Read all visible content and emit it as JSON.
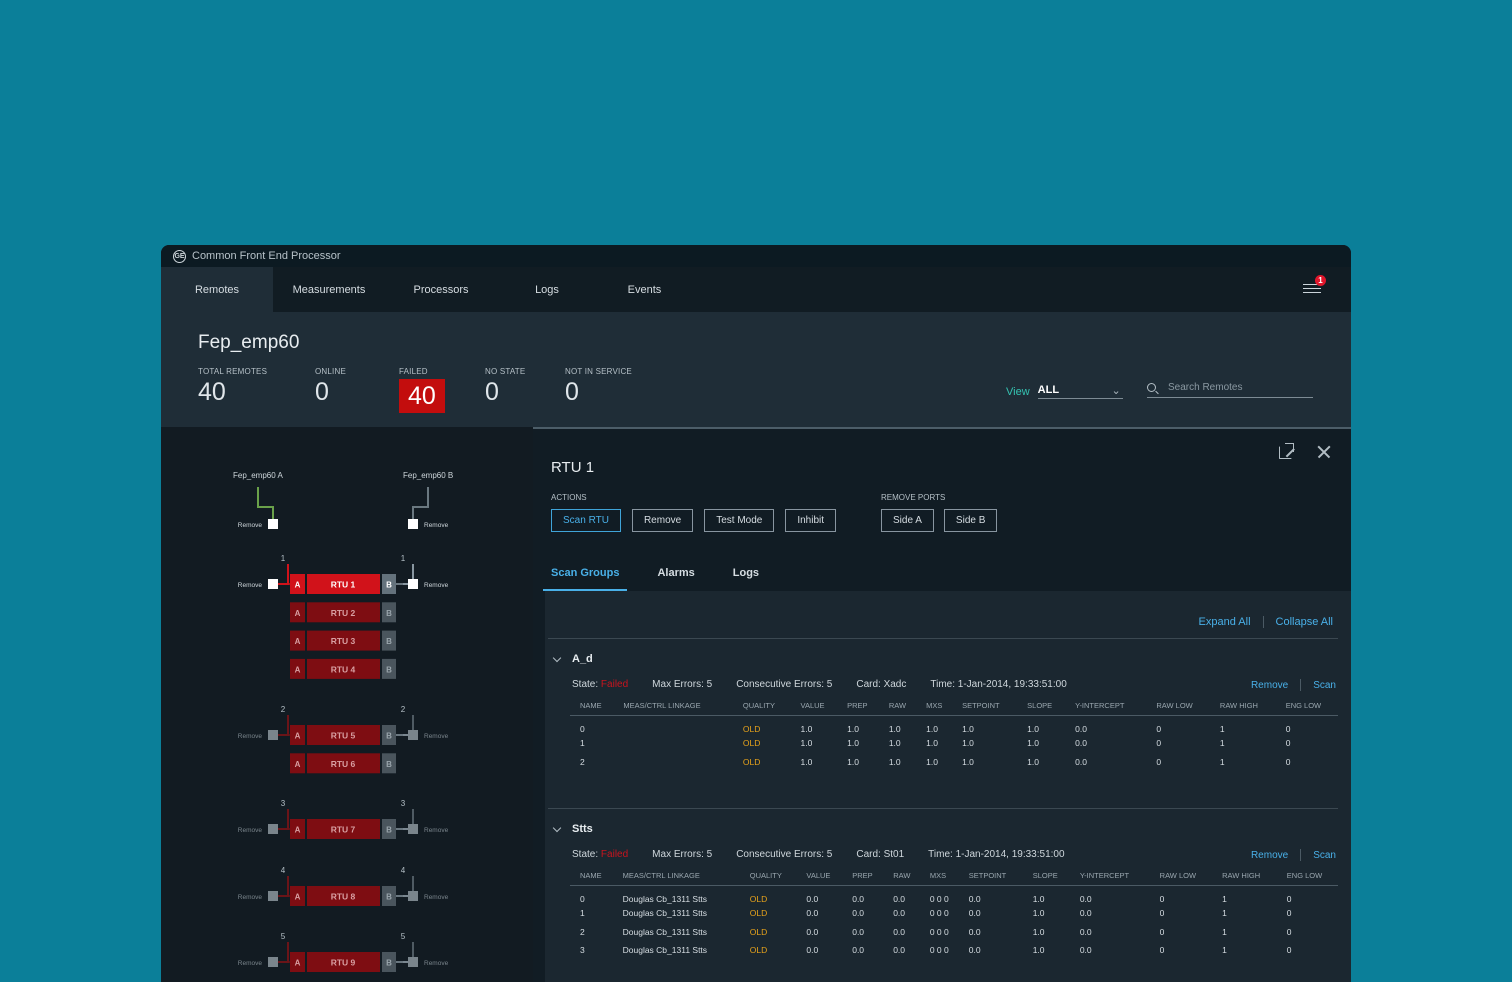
{
  "app": {
    "title": "Common Front End Processor",
    "logo": "GE"
  },
  "nav": {
    "tabs": [
      {
        "label": "Remotes",
        "active": true
      },
      {
        "label": "Measurements",
        "active": false
      },
      {
        "label": "Processors",
        "active": false
      },
      {
        "label": "Logs",
        "active": false
      },
      {
        "label": "Events",
        "active": false
      }
    ],
    "notifications": "1"
  },
  "summary": {
    "title": "Fep_emp60",
    "stats": [
      {
        "label": "TOTAL REMOTES",
        "value": "40"
      },
      {
        "label": "ONLINE",
        "value": "0"
      },
      {
        "label": "FAILED",
        "value": "40"
      },
      {
        "label": "NO STATE",
        "value": "0"
      },
      {
        "label": "NOT IN SERVICE",
        "value": "0"
      }
    ],
    "view_label": "View",
    "view_value": "ALL",
    "search_placeholder": "Search Remotes"
  },
  "topology": {
    "port_a_label": "Fep_emp60 A",
    "port_b_label": "Fep_emp60 B",
    "remove_label": "Remove",
    "side_a": "A",
    "side_b": "B",
    "groups": [
      {
        "num": "1",
        "rtus": [
          "RTU 1",
          "RTU 2",
          "RTU 3",
          "RTU 4"
        ]
      },
      {
        "num": "2",
        "rtus": [
          "RTU 5",
          "RTU 6"
        ]
      },
      {
        "num": "3",
        "rtus": [
          "RTU 7"
        ]
      },
      {
        "num": "4",
        "rtus": [
          "RTU 8"
        ]
      },
      {
        "num": "5",
        "rtus": [
          "RTU 9"
        ]
      }
    ],
    "colors": {
      "selected": "#d1121a",
      "rtu": "#7e0d12",
      "port": "#53606a",
      "green": "#6aa14a"
    }
  },
  "detail": {
    "title": "RTU 1",
    "actions_label": "ACTIONS",
    "actions": [
      "Scan RTU",
      "Remove",
      "Test Mode",
      "Inhibit"
    ],
    "remove_ports_label": "REMOVE PORTS",
    "remove_ports": [
      "Side A",
      "Side B"
    ],
    "tabs": [
      {
        "label": "Scan Groups",
        "active": true
      },
      {
        "label": "Alarms",
        "active": false
      },
      {
        "label": "Logs",
        "active": false
      }
    ],
    "expand_all": "Expand All",
    "collapse_all": "Collapse  All",
    "columns": [
      "NAME",
      "MEAS/CTRL LINKAGE",
      "QUALITY",
      "VALUE",
      "PREP",
      "RAW",
      "MXS",
      "SETPOINT",
      "SLOPE",
      "Y-INTERCEPT",
      "RAW LOW",
      "RAW HIGH",
      "ENG LOW"
    ],
    "groups": [
      {
        "name": "A_d",
        "state_label": "State:",
        "state": "Failed",
        "max_errors": "Max Errors:  5",
        "consecutive": "Consecutive Errors:  5",
        "card": "Card:  Xadc",
        "time": "Time:  1-Jan-2014, 19:33:51:00",
        "remove": "Remove",
        "scan": "Scan",
        "rows": [
          [
            "0",
            "",
            "OLD",
            "1.0",
            "1.0",
            "1.0",
            "1.0",
            "1.0",
            "1.0",
            "0.0",
            "0",
            "1",
            "0"
          ],
          [
            "1",
            "",
            "OLD",
            "1.0",
            "1.0",
            "1.0",
            "1.0",
            "1.0",
            "1.0",
            "0.0",
            "0",
            "1",
            "0"
          ],
          [
            "2",
            "",
            "OLD",
            "1.0",
            "1.0",
            "1.0",
            "1.0",
            "1.0",
            "1.0",
            "0.0",
            "0",
            "1",
            "0"
          ]
        ]
      },
      {
        "name": "Stts",
        "state_label": "State:",
        "state": "Failed",
        "max_errors": "Max Errors:  5",
        "consecutive": "Consecutive Errors:  5",
        "card": "Card:  St01",
        "time": "Time:  1-Jan-2014, 19:33:51:00",
        "remove": "Remove",
        "scan": "Scan",
        "rows": [
          [
            "0",
            "Douglas Cb_1311 Stts",
            "OLD",
            "0.0",
            "0.0",
            "0.0",
            "0 0 0",
            "0.0",
            "1.0",
            "0.0",
            "0",
            "1",
            "0"
          ],
          [
            "1",
            "Douglas Cb_1311 Stts",
            "OLD",
            "0.0",
            "0.0",
            "0.0",
            "0 0 0",
            "0.0",
            "1.0",
            "0.0",
            "0",
            "1",
            "0"
          ],
          [
            "2",
            "Douglas Cb_1311 Stts",
            "OLD",
            "0.0",
            "0.0",
            "0.0",
            "0 0 0",
            "0.0",
            "1.0",
            "0.0",
            "0",
            "1",
            "0"
          ],
          [
            "3",
            "Douglas Cb_1311 Stts",
            "OLD",
            "0.0",
            "0.0",
            "0.0",
            "0 0 0",
            "0.0",
            "1.0",
            "0.0",
            "0",
            "1",
            "0"
          ]
        ]
      }
    ]
  }
}
